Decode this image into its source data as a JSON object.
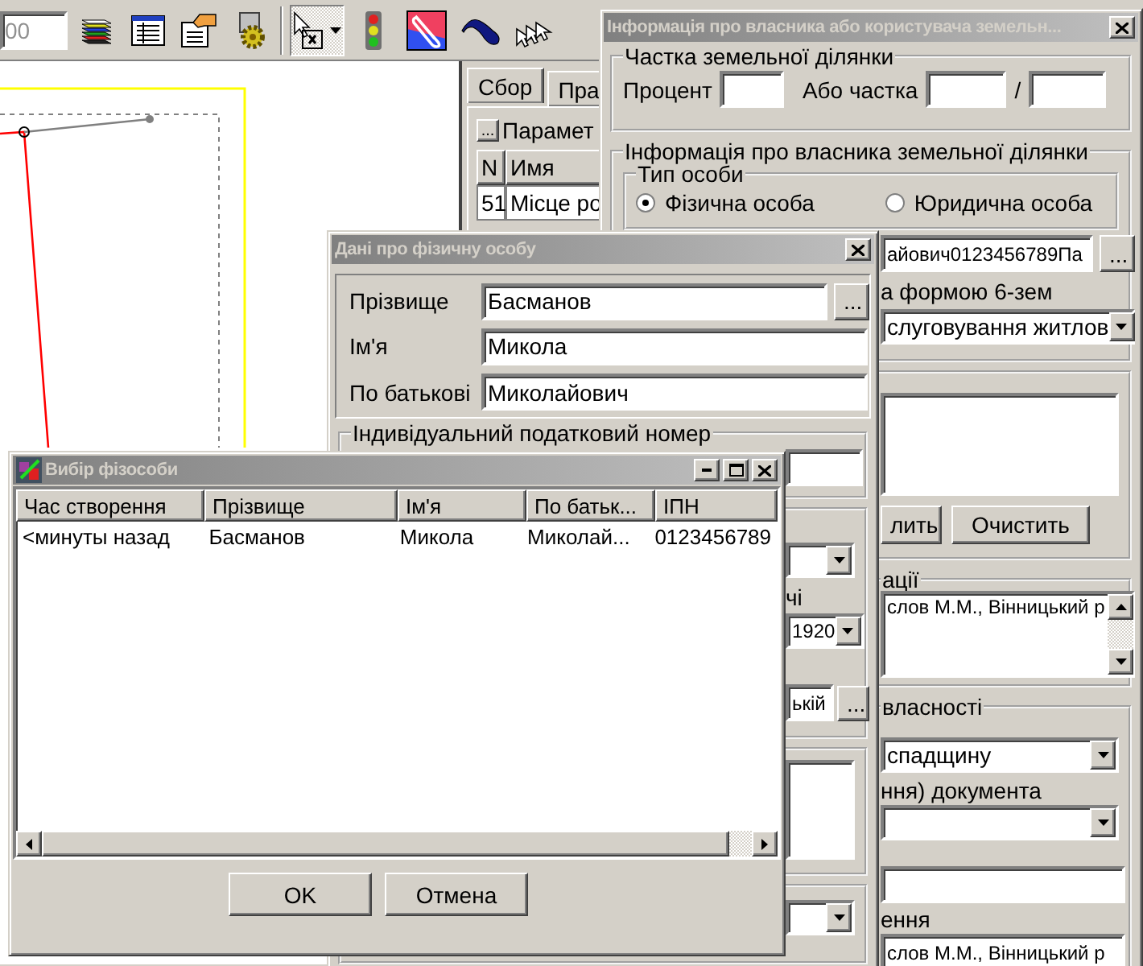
{
  "toolbar": {
    "field_value": "00",
    "tools": [
      {
        "selected": false
      },
      {
        "selected": false
      },
      {
        "selected": false
      },
      {
        "selected": false
      },
      {
        "selected": true
      },
      {
        "selected": false
      },
      {
        "selected": false
      },
      {
        "selected": false
      },
      {
        "selected": false
      }
    ]
  },
  "side_panel": {
    "tabs": [
      {
        "label": "Сбор",
        "selected": true
      },
      {
        "label": "Пра",
        "selected": false
      }
    ],
    "params_button": "...",
    "params_title": "Парамет",
    "columns": [
      "N",
      "Имя"
    ],
    "rows": [
      [
        "51",
        "Місце ро"
      ]
    ]
  },
  "owner_window": {
    "title": "Інформація про власника або користувача земельн...",
    "share_group": {
      "title": "Частка земельної ділянки",
      "percent_label": "Процент",
      "fraction_label": "Або частка",
      "separator": "/"
    },
    "owner_group": {
      "title": "Інформація про власника земельної ділянки",
      "person_type_title": "Тип особи",
      "person_types": [
        {
          "label": "Фізична особа",
          "selected": true
        },
        {
          "label": "Юридична особа",
          "selected": false
        }
      ],
      "owner_value": "айович0123456789Па",
      "browse_button": "...",
      "form_label": "а формою 6-зем",
      "purpose_value": "слуговування житлов"
    },
    "note_buttons": [
      "лить",
      "Очистить"
    ],
    "registration_group": {
      "title": "ації",
      "text": "слов М.М., Вінницький р"
    },
    "ownership_group": {
      "title": "власності",
      "basis_value": "спадщину",
      "document_label": "ння) документа",
      "issuer_label": "ення",
      "issuer_value": "слов М.М., Вінницький р"
    }
  },
  "person_dialog": {
    "title": "Дані про фізичну особу",
    "fields": [
      {
        "label": "Прізвище",
        "value": "Басманов"
      },
      {
        "label": "Ім'я",
        "value": "Микола"
      },
      {
        "label": "По батькові",
        "value": "Миколайович"
      }
    ],
    "browse_button": "...",
    "tax_title": "Індивідуальний податковий номер",
    "date_label": "чі",
    "year_value": "1920",
    "place_value": "ькій",
    "place_button": "..."
  },
  "picker_window": {
    "title": "Вибір фізособи",
    "columns": [
      "Час створення",
      "Прізвище",
      "Ім'я",
      "По батьк...",
      "ІПН"
    ],
    "rows": [
      [
        "<минуты назад",
        "Басманов",
        "Микола",
        "Миколай...",
        "0123456789"
      ]
    ],
    "buttons": [
      "OK",
      "Отмена"
    ]
  }
}
